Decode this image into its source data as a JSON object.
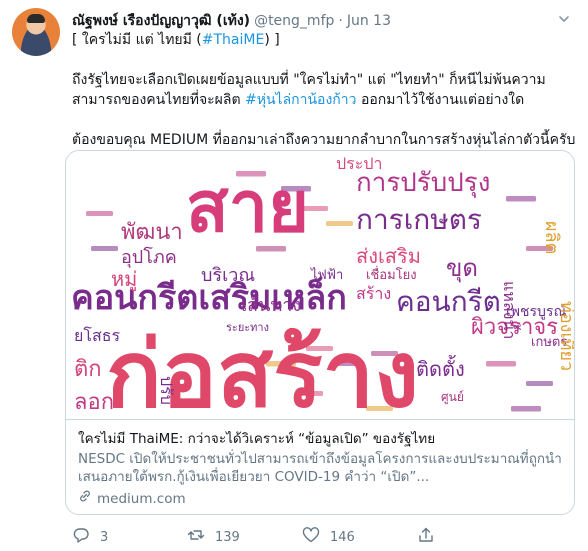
{
  "tweet": {
    "name": "ณัฐพงษ์ เรืองปัญญาวุฒิ (เท้ง)",
    "handle": "@teng_mfp",
    "separator": "·",
    "date": "Jun 13",
    "line1_prefix": "[ ใครไม่มี แต่ ไทยมี (",
    "line1_hashtag": "#ThaiME",
    "line1_suffix": ") ]",
    "para2_a": "ถึงรัฐไทยจะเลือกเปิดเผยข้อมูลแบบที่ \"ใครไม่ทำ\" แต่ \"ไทยทำ\" ก็หนีไม่พ้นความสามารถของคนไทยที่จะผลิต ",
    "para2_hashtag": "#หุ่นไล่กาน้องก้าว",
    "para2_b": " ออกมาไว้ใช้งานแต่อย่างใด",
    "para3": "ต้องขอบคุณ MEDIUM ที่ออกมาเล่าถึงความยากลำบากในการสร้างหุ่นไล่กาตัวนี้ครับ"
  },
  "card": {
    "title": "ใครไม่มี ThaiME: กว่าจะได้วิเคราะห์ “ข้อมูลเปิด” ของรัฐไทย",
    "description": "NESDC เปิดให้ประชาชนทั่วไปสามารถเข้าถึงข้อมูลโครงการและงบประมาณที่ถูกนำเสนอภายใต้พรก.กู้เงินเพื่อเยียวยา COVID-19 คำว่า “เปิด”...",
    "domain": "medium.com",
    "image_words": [
      {
        "text": "ก่อสร้าง",
        "color": "#e0486a"
      },
      {
        "text": "สาย",
        "color": "#d63d7a"
      },
      {
        "text": "คอนกรีตเสริมเหล็ก",
        "color": "#7a2c8c"
      },
      {
        "text": "การปรับปรุง",
        "color": "#b2358c"
      },
      {
        "text": "การเกษตร",
        "color": "#7a2c8c"
      },
      {
        "text": "คอนกรีต",
        "color": "#6a2f8f"
      },
      {
        "text": "ผิวจราจร",
        "color": "#c23a86"
      },
      {
        "text": "ส่งเสริม",
        "color": "#d94a7a"
      },
      {
        "text": "ขุด",
        "color": "#8a2e8c"
      },
      {
        "text": "พัฒนา",
        "color": "#b03a7c"
      },
      {
        "text": "อุปโภค",
        "color": "#8e2f86"
      },
      {
        "text": "หมู่",
        "color": "#d4447a"
      },
      {
        "text": "บริเวณ",
        "color": "#7a2c8c"
      },
      {
        "text": "เส้นทาง",
        "color": "#8a2e8c"
      },
      {
        "text": "ติดตั้ง",
        "color": "#7a2c8c"
      },
      {
        "text": "สร้าง",
        "color": "#c23a86"
      },
      {
        "text": "เพชรบูรณ์",
        "color": "#6a2f8f"
      },
      {
        "text": "เกษตร",
        "color": "#8a2e8c"
      },
      {
        "text": "ประปา",
        "color": "#d94a7a"
      },
      {
        "text": "ยโสธร",
        "color": "#6a2f8f"
      },
      {
        "text": "ไฟฟ้า",
        "color": "#7a2c8c"
      },
      {
        "text": "เชื่อมโยง",
        "color": "#a8357c"
      },
      {
        "text": "ท่องเที่ยว",
        "color": "#e0a030"
      },
      {
        "text": "ผลิต",
        "color": "#e0a030"
      },
      {
        "text": "แหล่งน้ำ",
        "color": "#8a2e8c"
      },
      {
        "text": "ติก",
        "color": "#d4447a"
      },
      {
        "text": "ลอก",
        "color": "#c23a86"
      },
      {
        "text": "ปรับ",
        "color": "#7a2c8c"
      },
      {
        "text": "ศูนย์",
        "color": "#a8357c"
      },
      {
        "text": "ระยะทาง",
        "color": "#7a2c8c"
      }
    ]
  },
  "actions": {
    "replies": "3",
    "retweets": "139",
    "likes": "146"
  },
  "colors": {
    "link": "#1b95e0",
    "secondary_text": "#657786",
    "border": "#ccd6dd"
  },
  "icons": [
    "caret-down-icon",
    "link-icon",
    "reply-icon",
    "retweet-icon",
    "like-icon",
    "share-icon"
  ]
}
